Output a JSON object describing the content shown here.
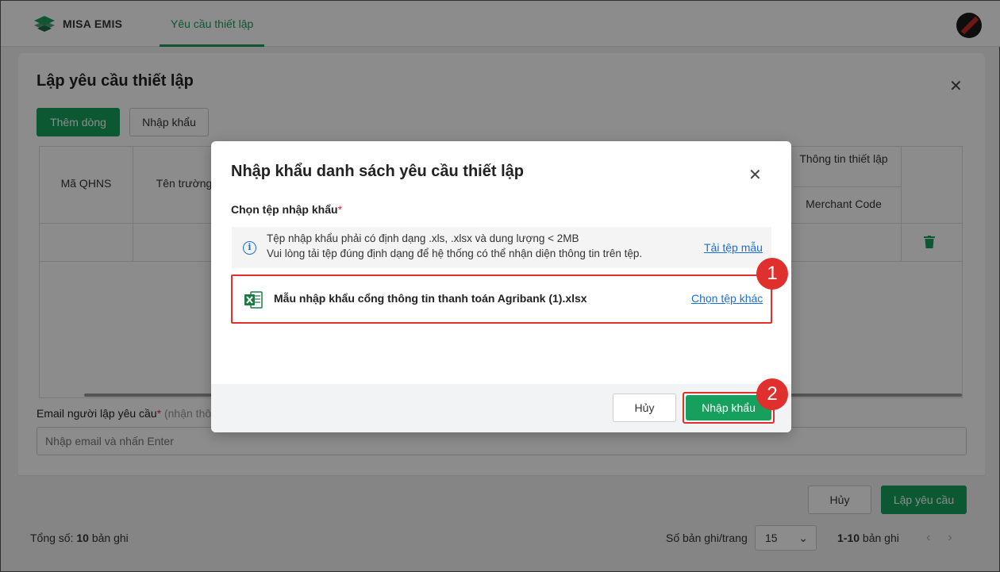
{
  "app": {
    "brand": "MISA EMIS",
    "tab": "Yêu cầu thiết lập"
  },
  "footer": {
    "total_label": "Tổng số:",
    "total_value": "10",
    "total_unit": "bản ghi",
    "per_page_label": "Số bản ghi/trang",
    "per_page_value": "15",
    "range": "1-10",
    "range_unit": "bản ghi"
  },
  "setup_modal": {
    "title": "Lập yêu cầu thiết lập",
    "add_row": "Thêm dòng",
    "import": "Nhập khẩu",
    "columns": {
      "qhns": "Mã QHNS",
      "school": "Tên trường",
      "info_group": "Thông tin thiết lập",
      "merchant": "Merchant Code"
    },
    "email_label": "Email người lập yêu cầu",
    "email_hint": "(nhận thô",
    "email_placeholder": "Nhập email và nhấn Enter",
    "cancel": "Hủy",
    "submit": "Lập yêu cầu"
  },
  "import_dialog": {
    "title": "Nhập khẩu danh sách yêu cầu thiết lập",
    "file_label": "Chọn tệp nhập khẩu",
    "info_line1": "Tệp nhập khẩu phải có định dạng .xls, .xlsx và dung lượng < 2MB",
    "info_line2": "Vui lòng tải tệp đúng định dạng để hệ thống có thể nhận diện thông tin trên tệp.",
    "template_link": "Tải tệp mẫu",
    "file_name": "Mẫu nhập khẩu cổng thông tin thanh toán Agribank (1).xlsx",
    "change_file": "Chọn tệp khác",
    "cancel": "Hủy",
    "submit": "Nhập khẩu"
  },
  "annotations": {
    "step1": "1",
    "step2": "2"
  },
  "colors": {
    "primary": "#17a05d",
    "highlight": "#e0302d",
    "link": "#1b6fd2"
  }
}
